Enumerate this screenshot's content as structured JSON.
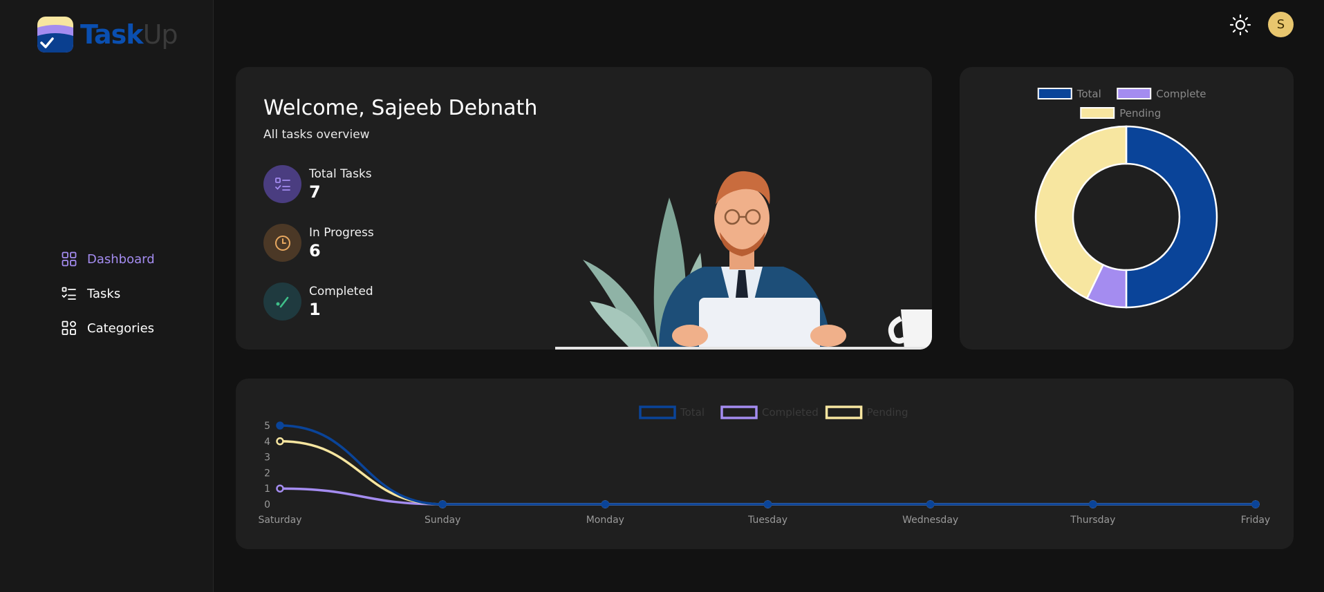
{
  "app": {
    "name_part1": "Task",
    "name_part2": "Up"
  },
  "sidebar": {
    "items": [
      {
        "label": "Dashboard",
        "icon": "dashboard-icon",
        "active": true
      },
      {
        "label": "Tasks",
        "icon": "tasks-icon",
        "active": false
      },
      {
        "label": "Categories",
        "icon": "categories-icon",
        "active": false
      }
    ]
  },
  "header": {
    "theme_icon": "sun-icon",
    "avatar_initial": "S"
  },
  "welcome": {
    "title": "Welcome, Sajeeb Debnath",
    "subtitle": "All tasks overview",
    "stats": [
      {
        "label": "Total Tasks",
        "value": "7",
        "icon": "checklist-icon"
      },
      {
        "label": "In Progress",
        "value": "6",
        "icon": "clock-icon"
      },
      {
        "label": "Completed",
        "value": "1",
        "icon": "check-icon"
      }
    ]
  },
  "colors": {
    "total": "#0a4499",
    "complete": "#a48cf0",
    "pending": "#f7e6a0",
    "accent": "#a48cf0"
  },
  "chart_data": [
    {
      "type": "pie",
      "labels": [
        "Total",
        "Complete",
        "Pending"
      ],
      "values": [
        7,
        1,
        6
      ],
      "legend": "top"
    },
    {
      "type": "line",
      "categories": [
        "Saturday",
        "Sunday",
        "Monday",
        "Tuesday",
        "Wednesday",
        "Thursday",
        "Friday"
      ],
      "series": [
        {
          "name": "Total",
          "values": [
            5,
            0,
            0,
            0,
            0,
            0,
            0
          ]
        },
        {
          "name": "Completed",
          "values": [
            1,
            0,
            0,
            0,
            0,
            0,
            0
          ]
        },
        {
          "name": "Pending",
          "values": [
            4,
            0,
            0,
            0,
            0,
            0,
            0
          ]
        }
      ],
      "yticks": [
        "0",
        "1",
        "2",
        "3",
        "4",
        "5"
      ],
      "ylim": [
        0,
        5
      ],
      "legend": "top"
    }
  ]
}
